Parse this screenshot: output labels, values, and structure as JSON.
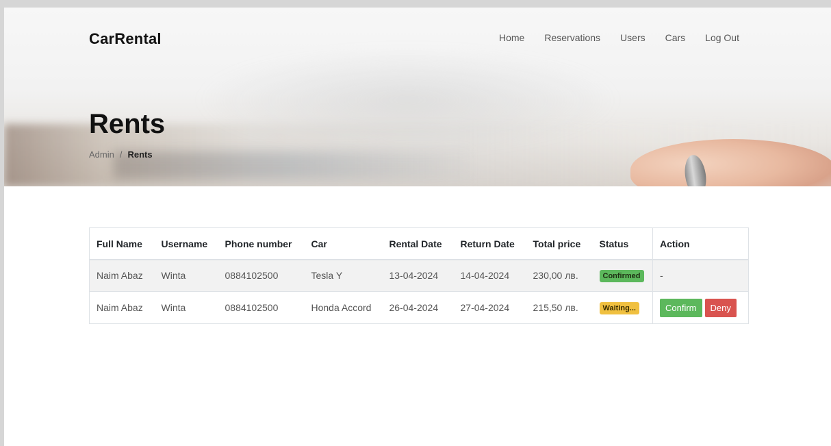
{
  "app": {
    "brand": "CarRental"
  },
  "nav": {
    "items": [
      {
        "label": "Home"
      },
      {
        "label": "Reservations"
      },
      {
        "label": "Users"
      },
      {
        "label": "Cars"
      },
      {
        "label": "Log Out"
      }
    ]
  },
  "hero": {
    "title": "Rents",
    "breadcrumb": {
      "parent": "Admin",
      "separator": "/",
      "current": "Rents"
    }
  },
  "table": {
    "headers": [
      "Full Name",
      "Username",
      "Phone number",
      "Car",
      "Rental Date",
      "Return Date",
      "Total price",
      "Status",
      "Action"
    ],
    "rows": [
      {
        "full_name": "Naim Abaz",
        "username": "Winta",
        "phone": "0884102500",
        "car": "Tesla Y",
        "rental_date": "13-04-2024",
        "return_date": "14-04-2024",
        "total_price": "230,00 лв.",
        "status": "Confirmed",
        "status_color": "#5cb85c",
        "action": "-"
      },
      {
        "full_name": "Naim Abaz",
        "username": "Winta",
        "phone": "0884102500",
        "car": "Honda Accord",
        "rental_date": "26-04-2024",
        "return_date": "27-04-2024",
        "total_price": "215,50 лв.",
        "status": "Waiting...",
        "status_color": "#f0c040",
        "confirm_label": "Confirm",
        "deny_label": "Deny"
      }
    ]
  },
  "colors": {
    "confirm": "#5cb85c",
    "deny": "#d9534f",
    "waiting": "#f0c040"
  }
}
